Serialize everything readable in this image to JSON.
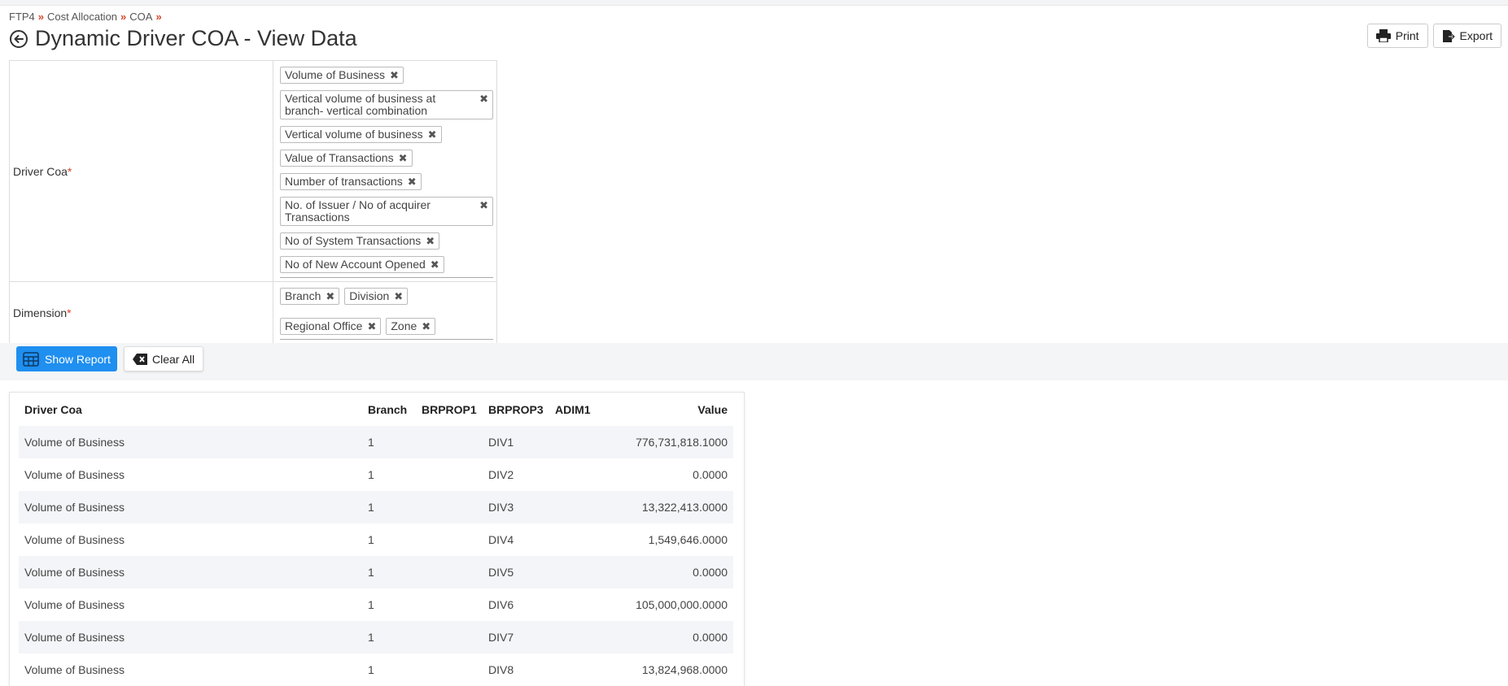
{
  "breadcrumb": [
    "FTP4",
    "Cost Allocation",
    "COA"
  ],
  "page_title": "Dynamic Driver COA - View Data",
  "toolbar": {
    "print_label": "Print",
    "export_label": "Export"
  },
  "filters": {
    "driver_coa": {
      "label": "Driver Coa",
      "tags": [
        "Volume of Business",
        "Vertical volume of business at branch- vertical combination",
        "Vertical volume of business",
        "Value of Transactions",
        "Number of transactions",
        "No. of Issuer / No of acquirer Transactions",
        "No of System Transactions",
        "No of New Account Opened"
      ]
    },
    "dimension": {
      "label": "Dimension",
      "tags": [
        "Branch",
        "Division",
        "Regional Office",
        "Zone"
      ]
    }
  },
  "actions": {
    "show_report": "Show Report",
    "clear_all": "Clear All"
  },
  "table": {
    "columns": [
      "Driver Coa",
      "Branch",
      "BRPROP1",
      "BRPROP3",
      "ADIM1",
      "Value"
    ],
    "rows": [
      [
        "Volume of Business",
        "1",
        "",
        "DIV1",
        "",
        "776,731,818.1000"
      ],
      [
        "Volume of Business",
        "1",
        "",
        "DIV2",
        "",
        "0.0000"
      ],
      [
        "Volume of Business",
        "1",
        "",
        "DIV3",
        "",
        "13,322,413.0000"
      ],
      [
        "Volume of Business",
        "1",
        "",
        "DIV4",
        "",
        "1,549,646.0000"
      ],
      [
        "Volume of Business",
        "1",
        "",
        "DIV5",
        "",
        "0.0000"
      ],
      [
        "Volume of Business",
        "1",
        "",
        "DIV6",
        "",
        "105,000,000.0000"
      ],
      [
        "Volume of Business",
        "1",
        "",
        "DIV7",
        "",
        "0.0000"
      ],
      [
        "Volume of Business",
        "1",
        "",
        "DIV8",
        "",
        "13,824,968.0000"
      ]
    ]
  },
  "colors": {
    "accent": "#1f8ff0",
    "required": "#d9452b",
    "row_alt": "#f4f5f8"
  }
}
